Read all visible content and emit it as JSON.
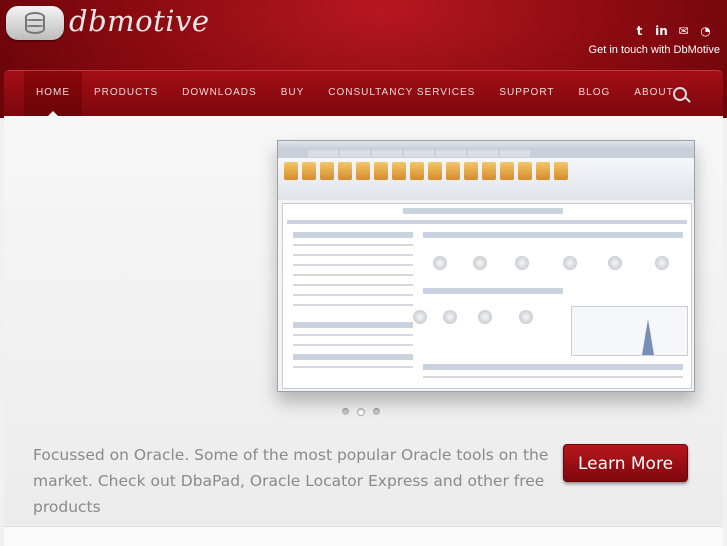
{
  "brand": {
    "name": "dbmotive"
  },
  "social": {
    "touch_text": "Get in touch with DbMotive",
    "icons": [
      "twitter-icon",
      "linkedin-icon",
      "email-icon",
      "rss-icon"
    ]
  },
  "nav": {
    "items": [
      "HOME",
      "PRODUCTS",
      "DOWNLOADS",
      "BUY",
      "CONSULTANCY SERVICES",
      "SUPPORT",
      "BLOG",
      "ABOUT"
    ],
    "active": "HOME"
  },
  "hero": {
    "tagline": "Focussed on Oracle. Some of the most popular Oracle tools on the market. Check out DbaPad, Oracle Locator Express and other free products",
    "cta_label": "Learn More",
    "slides_count": 3,
    "active_slide": 2
  },
  "colors": {
    "brand_red": "#8d0b12",
    "button_red": "#a3121a",
    "text_gray": "#8a8a8a"
  }
}
